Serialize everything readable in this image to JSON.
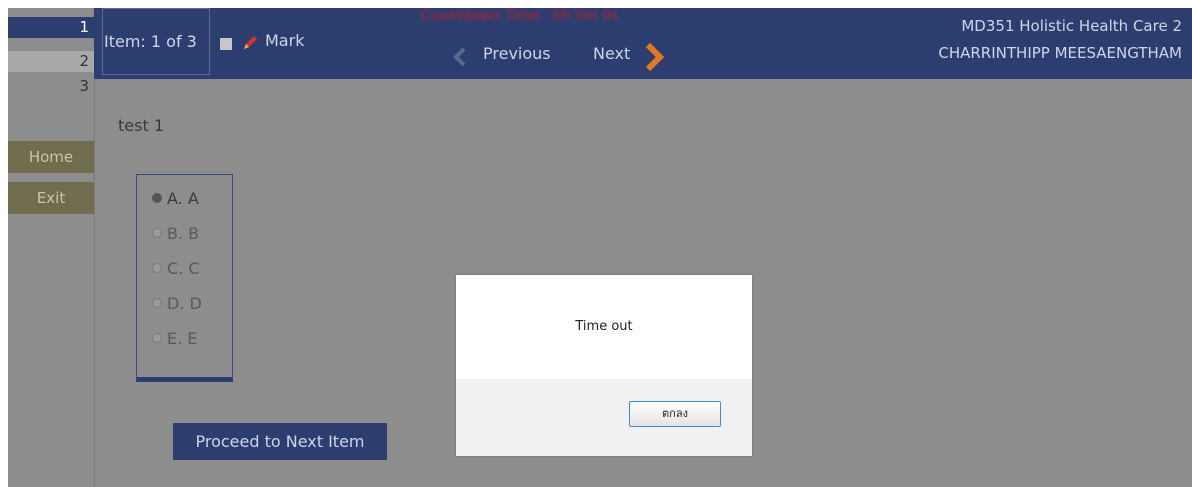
{
  "nav": {
    "numbers": [
      "1",
      "2",
      "3"
    ],
    "home_label": "Home",
    "exit_label": "Exit"
  },
  "header": {
    "item_label": "Item: 1 of 3",
    "mark_label": "Mark",
    "timer_text": "Countdown Time : 0h 0m 0s",
    "previous_label": "Previous",
    "next_label": "Next",
    "course_title": "MD351 Holistic Health Care 2",
    "student_name": "CHARRINTHIPP  MEESAENGTHAM"
  },
  "question": {
    "text": "test 1",
    "options": [
      {
        "label": "A. A",
        "selected": true
      },
      {
        "label": "B. B",
        "selected": false
      },
      {
        "label": "C. C",
        "selected": false
      },
      {
        "label": "D. D",
        "selected": false
      },
      {
        "label": "E. E",
        "selected": false
      }
    ],
    "proceed_label": "Proceed to Next Item"
  },
  "dialog": {
    "message": "Time out",
    "ok_label": "ตกลง"
  },
  "icons": {
    "mark": "pencil-icon",
    "previous": "chevron-left-icon",
    "next": "chevron-right-icon"
  },
  "colors": {
    "header_bg": "#2c3e70",
    "content_bg": "#8d8d8d",
    "side_button_bg": "#706c4e",
    "timer_red": "#c41f2a",
    "next_arrow": "#e07a1e"
  }
}
